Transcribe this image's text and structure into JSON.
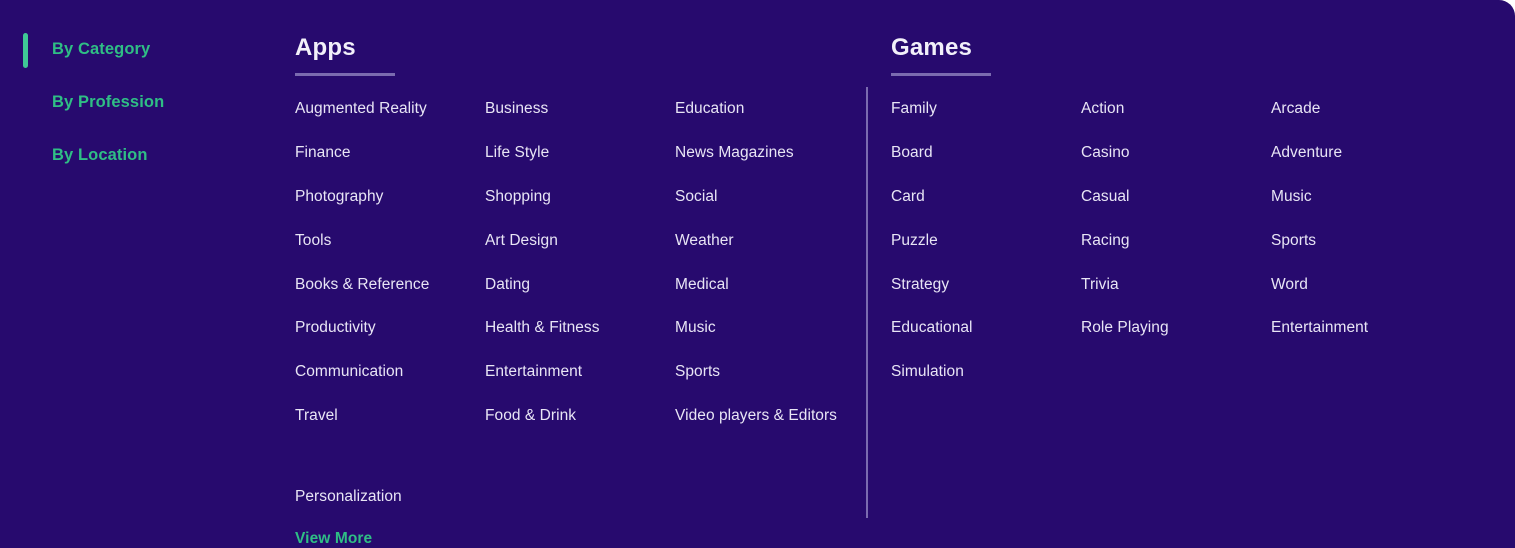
{
  "theme": {
    "background": "#270a6e",
    "accent_green": "#2fbe85",
    "text_primary": "#e8e5f5",
    "divider": "#7b6bb0"
  },
  "sidebar": {
    "items": [
      {
        "label": "By Category",
        "active": true
      },
      {
        "label": "By Profession",
        "active": false
      },
      {
        "label": "By Location",
        "active": false
      }
    ]
  },
  "apps": {
    "title": "Apps",
    "columns": [
      {
        "items": [
          "Augmented Reality",
          "Finance",
          "Photography",
          "Tools",
          "Books & Reference",
          "Productivity",
          "Communication",
          "Travel",
          "Personalization"
        ],
        "view_more": "View More"
      },
      {
        "items": [
          "Business",
          "Life Style",
          "Shopping",
          "Art Design",
          "Dating",
          "Health & Fitness",
          "Entertainment",
          "Food & Drink"
        ]
      },
      {
        "items": [
          "Education",
          "News Magazines",
          "Social",
          "Weather",
          "Medical",
          "Music",
          "Sports",
          "Video players & Editors"
        ]
      }
    ]
  },
  "games": {
    "title": "Games",
    "columns": [
      {
        "items": [
          "Family",
          "Board",
          "Card",
          "Puzzle",
          "Strategy",
          "Educational",
          "Simulation"
        ]
      },
      {
        "items": [
          "Action",
          "Casino",
          "Casual",
          "Racing",
          "Trivia",
          "Role Playing"
        ]
      },
      {
        "items": [
          "Arcade",
          "Adventure",
          "Music",
          "Sports",
          "Word",
          "Entertainment"
        ]
      }
    ]
  }
}
